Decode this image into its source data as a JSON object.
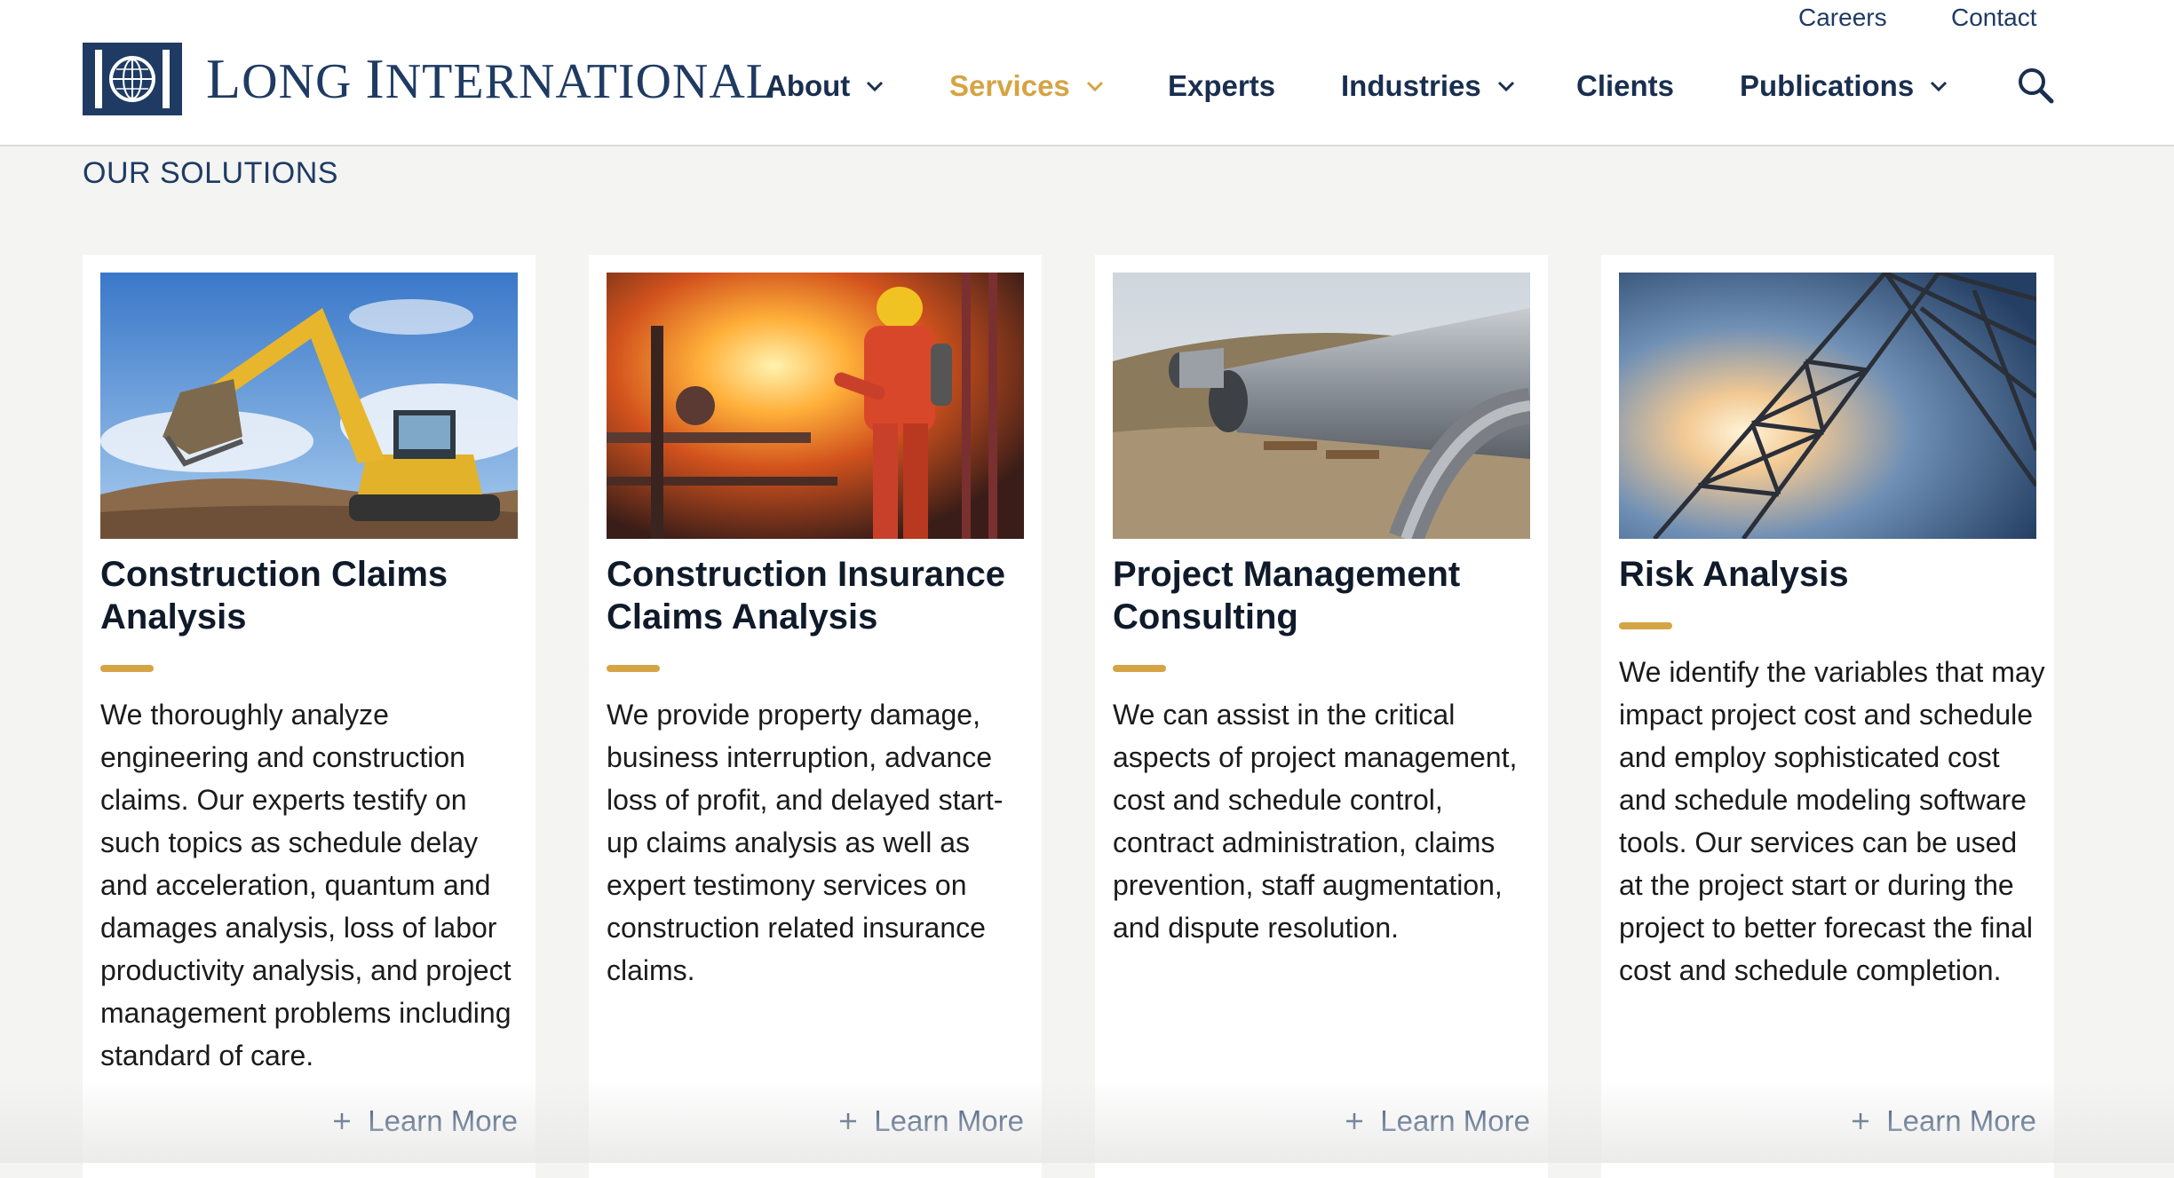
{
  "header": {
    "utility": {
      "careers": "Careers",
      "contact": "Contact"
    },
    "logo": {
      "first_initial": "L",
      "first_rest": "ONG ",
      "second_initial": "I",
      "second_rest": "NTERNATIONAL"
    },
    "nav": {
      "about": "About",
      "services": "Services",
      "experts": "Experts",
      "industries": "Industries",
      "clients": "Clients",
      "publications": "Publications"
    },
    "icons": {
      "search": "search-icon",
      "chevron": "chevron-down-icon"
    },
    "active_color": "#d5a444",
    "nav_color": "#1a2f4f"
  },
  "section": {
    "title": "OUR SOLUTIONS"
  },
  "cards": [
    {
      "title": "Construction Claims Analysis",
      "description": "We thoroughly analyze engineering and construction claims. Our experts testify on such topics as schedule delay and acceleration, quantum and damages analysis, loss of labor productivity analysis, and project management problems including standard of care.",
      "link": "Learn More",
      "image": "excavator-photo"
    },
    {
      "title": "Construction Insurance Claims Analysis",
      "description": "We provide property damage, business interruption, advance loss of profit, and delayed start-up claims analysis as well as expert testimony services on construction related insurance claims.",
      "link": "Learn More",
      "image": "firefighter-photo"
    },
    {
      "title": "Project Management Consulting",
      "description": "We can assist in the critical aspects of project management, cost and schedule control, contract administration, claims prevention, staff augmentation, and dispute resolution.",
      "link": "Learn More",
      "image": "pipeline-photo"
    },
    {
      "title": "Risk Analysis",
      "description": "We identify the variables that may impact project cost and schedule and employ sophisticated cost and schedule modeling software tools. Our services can be used at the project start or during the project to better forecast the final cost and schedule completion.",
      "link": "Learn More",
      "image": "power-tower-photo"
    }
  ],
  "accent_color": "#d5a444"
}
